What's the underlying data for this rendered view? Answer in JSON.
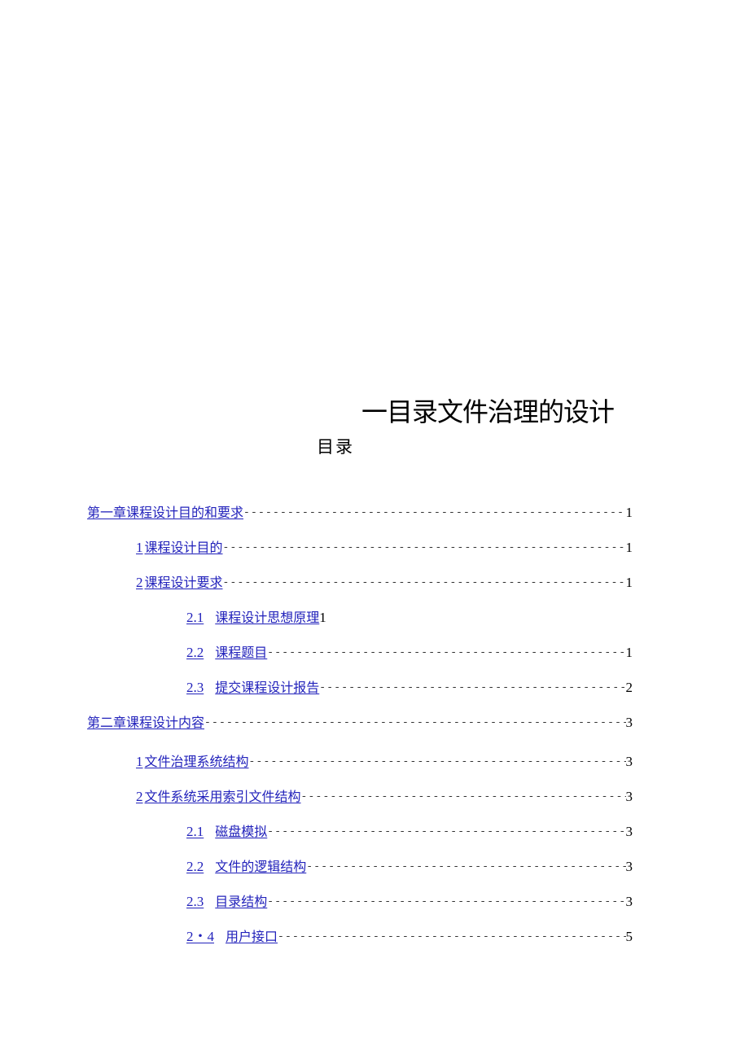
{
  "document": {
    "title": "一目录文件治理的设计",
    "toc_heading": "目录"
  },
  "toc": [
    {
      "level": 1,
      "number": "",
      "label": "第一章课程设计目的和要求",
      "leader": true,
      "page": "1"
    },
    {
      "level": 2,
      "number": "1",
      "label": "课程设计目的",
      "leader": true,
      "page": "1"
    },
    {
      "level": 2,
      "number": "2",
      "label": "课程设计要求",
      "leader": true,
      "page": "1"
    },
    {
      "level": 3,
      "number": "2.1",
      "label": "课程设计思想原理",
      "leader": false,
      "page": "1"
    },
    {
      "level": 3,
      "number": "2.2",
      "label": "课程题目",
      "leader": true,
      "page": "1"
    },
    {
      "level": 3,
      "number": "2.3",
      "label": "提交课程设计报告",
      "leader": true,
      "page": "2"
    },
    {
      "level": 1,
      "number": "",
      "label": "第二章课程设计内容",
      "leader": true,
      "page": "3"
    },
    {
      "level": 2,
      "number": "1",
      "label": "文件治理系统结构",
      "leader": true,
      "page": "3"
    },
    {
      "level": 2,
      "number": "2",
      "label": "文件系统采用索引文件结构",
      "leader": true,
      "page": "3"
    },
    {
      "level": 3,
      "number": "2.1",
      "label": "磁盘模拟",
      "leader": true,
      "page": "3"
    },
    {
      "level": 3,
      "number": "2.2",
      "label": "文件的逻辑结构",
      "leader": true,
      "page": "3"
    },
    {
      "level": 3,
      "number": "2.3",
      "label": "目录结构",
      "leader": true,
      "page": "3"
    },
    {
      "level": 3,
      "number": "2・4",
      "label": "用户接口",
      "leader": true,
      "page": "5"
    }
  ],
  "colors": {
    "link": "#2222bb",
    "text": "#000000",
    "leader": "#333333"
  }
}
